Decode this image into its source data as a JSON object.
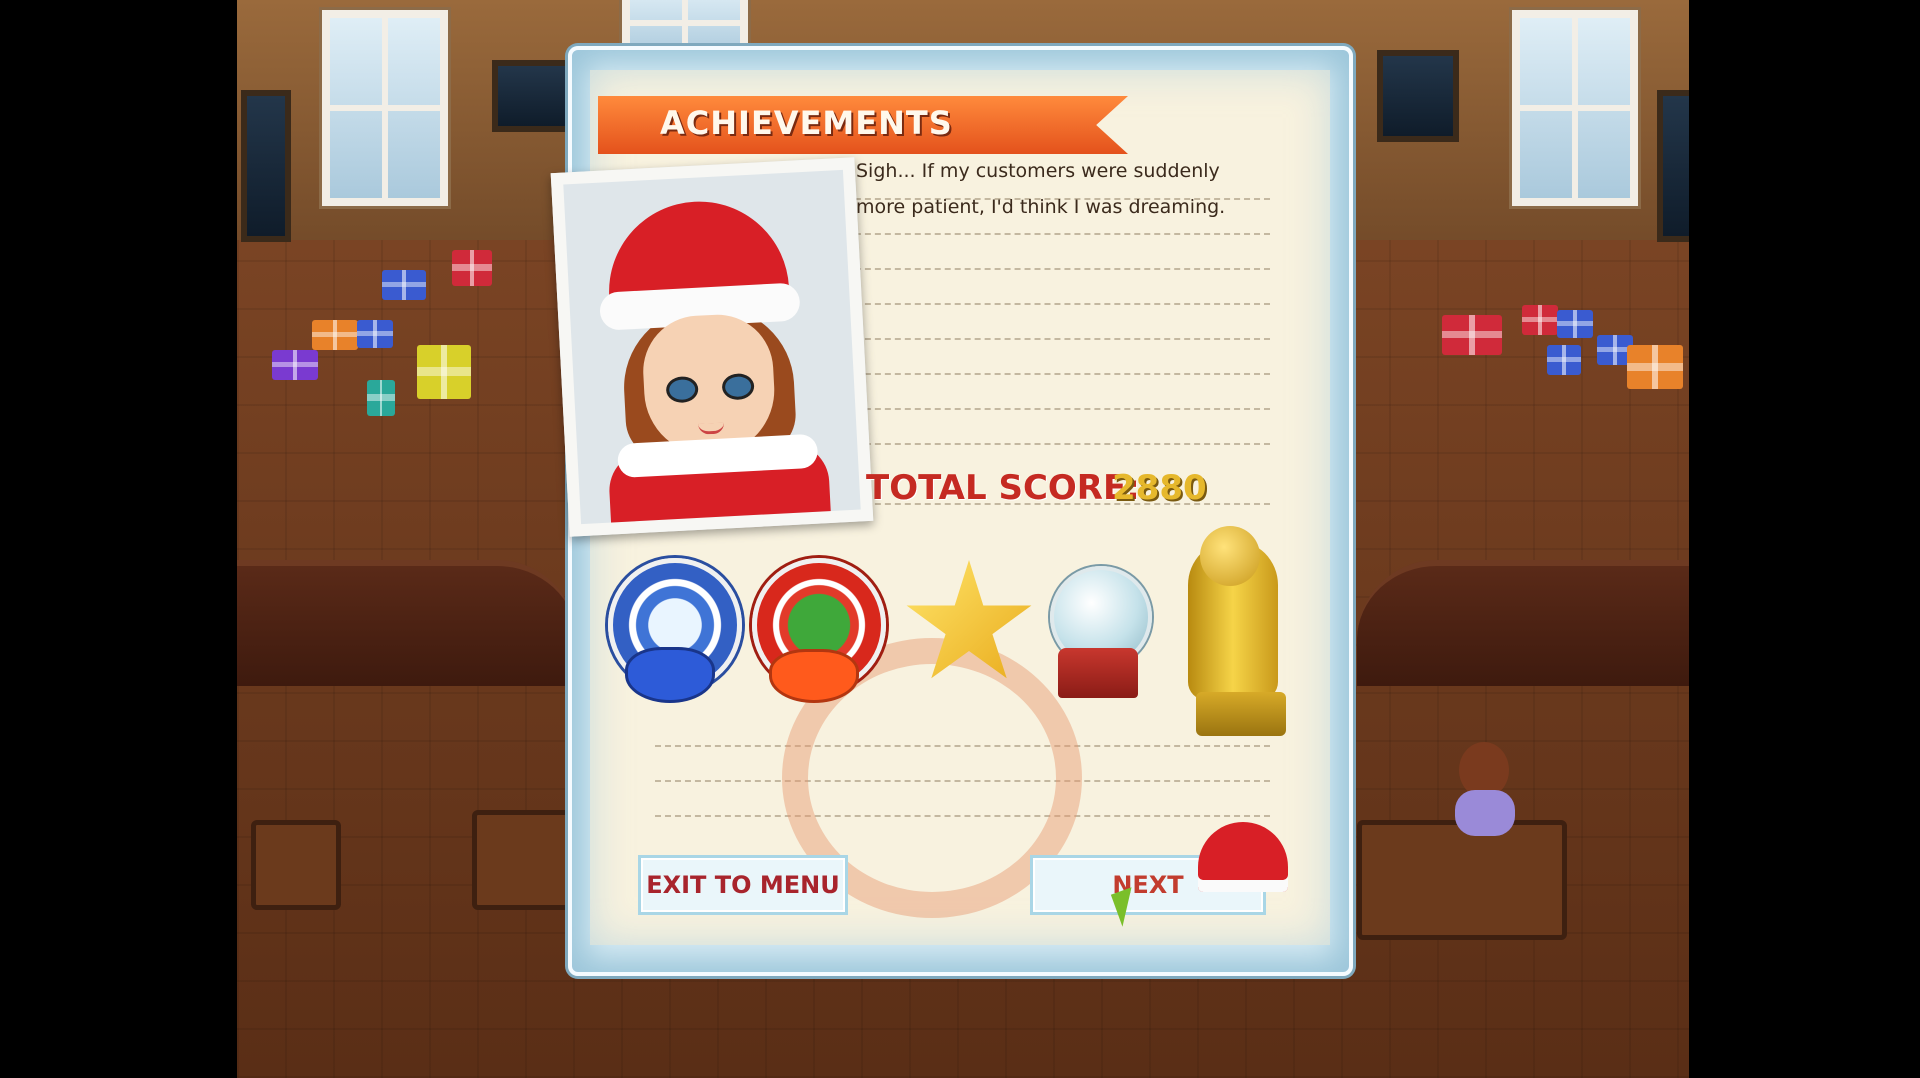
{
  "panel": {
    "title": "ACHIEVEMENTS",
    "quote_lines": [
      "Sigh...  If my customers were suddenly",
      "more patient, I'd think I was dreaming."
    ],
    "score_label": "TOTAL SCORE:",
    "score_value": "2880",
    "buttons": {
      "exit": "EXIT TO MENU",
      "next": "NEXT"
    }
  },
  "achievements": [
    {
      "icon": "snowmen-badge-icon"
    },
    {
      "icon": "gift-box-badge-icon"
    },
    {
      "icon": "gold-star-icon"
    },
    {
      "icon": "snow-globe-icon"
    },
    {
      "icon": "golden-santa-trophy-icon"
    }
  ],
  "colors": {
    "ribbon": "#e4521c",
    "score_label": "#c52a22",
    "score_value": "#e6b82c",
    "button_text": "#a8242c"
  }
}
